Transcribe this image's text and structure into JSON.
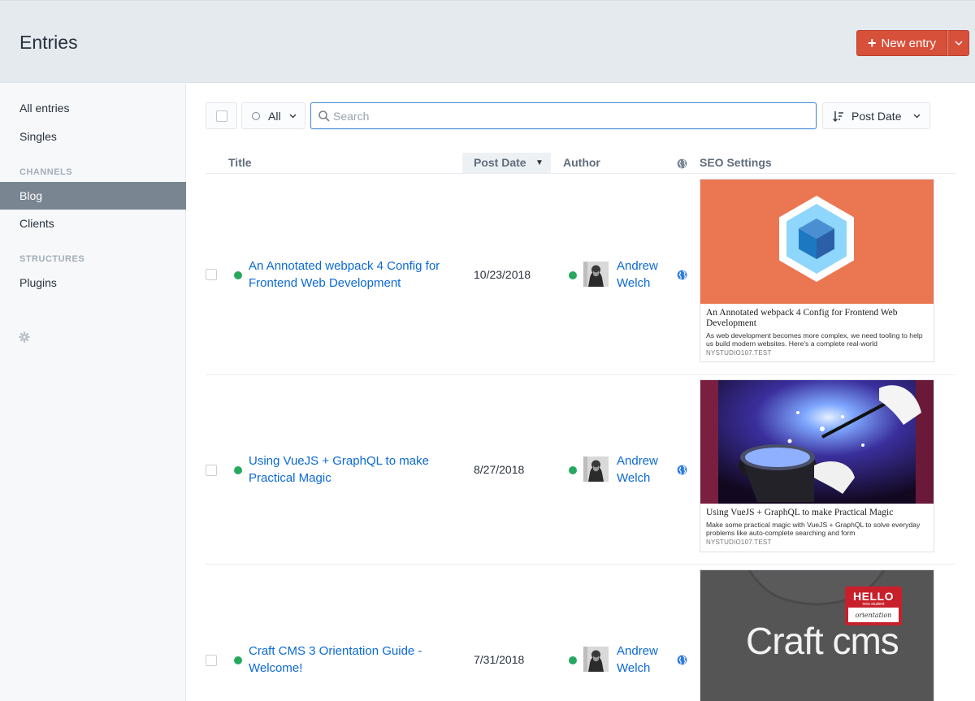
{
  "header": {
    "title": "Entries",
    "new_entry_label": "New entry"
  },
  "sidebar": {
    "items": [
      {
        "label": "All entries"
      },
      {
        "label": "Singles"
      }
    ],
    "channels_heading": "CHANNELS",
    "channel_items": [
      {
        "label": "Blog",
        "active": true
      },
      {
        "label": "Clients"
      }
    ],
    "structures_heading": "STRUCTURES",
    "structure_items": [
      {
        "label": "Plugins"
      }
    ]
  },
  "toolbar": {
    "status_label": "All",
    "search_placeholder": "Search",
    "sort_label": "Post Date"
  },
  "table": {
    "columns": {
      "title": "Title",
      "post_date": "Post Date",
      "author": "Author",
      "seo": "SEO Settings"
    },
    "rows": [
      {
        "title_line1": "An Annotated webpack 4 Config for",
        "title_line2": "Frontend Web Development",
        "date": "10/23/2018",
        "author_first": "Andrew",
        "author_last": "Welch",
        "seo_title": "An Annotated webpack 4 Config for Frontend Web Development",
        "seo_desc": "As web development becomes more complex, we need tooling to help us build modern websites. Here's a complete real-world",
        "seo_site": "NYSTUDIO107.TEST"
      },
      {
        "title_line1": "Using VueJS + GraphQL to make",
        "title_line2": "Practical Magic",
        "date": "8/27/2018",
        "author_first": "Andrew",
        "author_last": "Welch",
        "seo_title": "Using VueJS + GraphQL to make Practical Magic",
        "seo_desc": "Make some practical magic with VueJS + GraphQL to solve everyday problems like auto-complete searching and form",
        "seo_site": "NYSTUDIO107.TEST"
      },
      {
        "title_line1": "Craft CMS 3 Orientation Guide -",
        "title_line2": "Welcome!",
        "date": "7/31/2018",
        "author_first": "Andrew",
        "author_last": "Welch",
        "seo_image_text": "Craft cms",
        "seo_badge_hello": "HELLO",
        "seo_badge_sub": "new student",
        "seo_badge_line": "orientation"
      }
    ]
  },
  "colors": {
    "accent": "#d7503a",
    "link": "#0b69d6",
    "status_live": "#27a85f",
    "sidebar_active": "#7a8592"
  },
  "icons": [
    "plus-icon",
    "chevron-down-icon",
    "gear-icon",
    "search-icon",
    "sort-icon",
    "globe-icon",
    "status-ring-icon"
  ]
}
